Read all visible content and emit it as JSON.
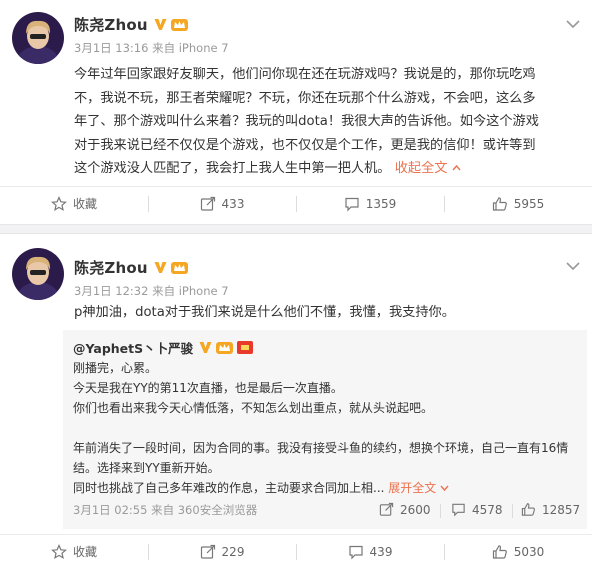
{
  "post1": {
    "author": "陈尧Zhou",
    "meta": "3月1日 13:16 来自 iPhone 7",
    "text_lines": [
      "今年过年回家跟好友聊天，他们问你现在还在玩游戏吗？我说是的，那你玩吃鸡",
      "不，我说不玩，那王者荣耀呢？不玩，你还在玩那个什么游戏，不会吧，这么多",
      "年了、那个游戏叫什么来着？我玩的叫dota！我很大声的告诉他。如今这个游戏",
      "对于我来说已经不仅仅是个游戏，也不仅仅是个工作，更是我的信仰！或许等到",
      "这个游戏没人匹配了，我会打上我人生中第一把人机。"
    ],
    "collapse_label": "收起全文",
    "actions": {
      "favorite": "收藏",
      "repost": "433",
      "comment": "1359",
      "like": "5955"
    }
  },
  "post2": {
    "author": "陈尧Zhou",
    "meta": "3月1日 12:32 来自 iPhone 7",
    "text": "p神加油，dota对于我们来说是什么他们不懂，我懂，我支持你。",
    "repost": {
      "author": "@YaphetS丶卜严骏",
      "text_lines": [
        "刚播完，心累。",
        "今天是我在YY的第11次直播，也是最后一次直播。",
        "你们也看出来我今天心情低落，不知怎么划出重点，就从头说起吧。",
        "",
        "年前消失了一段时间，因为合同的事。我没有接受斗鱼的续约，想换个环境，自己一直有16情",
        "结。选择来到YY重新开始。",
        "同时也挑战了自己多年难改的作息，主动要求合同加上相..."
      ],
      "expand_label": "展开全文",
      "meta": "3月1日 02:55 来自 360安全浏览器",
      "stats": {
        "repost": "2600",
        "comment": "4578",
        "like": "12857"
      }
    },
    "actions": {
      "favorite": "收藏",
      "repost": "229",
      "comment": "439",
      "like": "5030"
    }
  },
  "colors": {
    "link": "#eb7350",
    "verified": "#f5a623",
    "meta": "#9a9a9a"
  }
}
